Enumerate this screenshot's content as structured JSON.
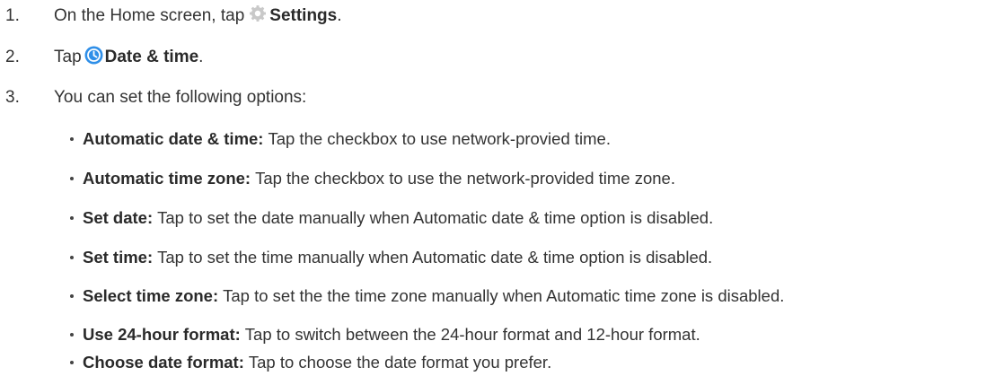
{
  "steps": [
    {
      "num": "1.",
      "pre": "On the Home screen, tap ",
      "icon": "gear-icon",
      "bold": "Settings",
      "post": "."
    },
    {
      "num": "2.",
      "pre": "Tap ",
      "icon": "clock-icon",
      "bold": "Date & time",
      "post": "."
    },
    {
      "num": "3.",
      "pre": "You can set the following options:",
      "icon": "",
      "bold": "",
      "post": ""
    }
  ],
  "options": [
    {
      "term": "Automatic date & time:",
      "desc": "Tap the checkbox to use network-provied time."
    },
    {
      "term": "Automatic time zone:",
      "desc": "Tap the checkbox to use the network-provided time zone."
    },
    {
      "term": "Set date:",
      "desc": "Tap to set the date manually when Automatic date & time option is disabled."
    },
    {
      "term": "Set time:",
      "desc": "Tap to set the time manually when Automatic date & time option is disabled."
    },
    {
      "term": "Select time zone:",
      "desc": "Tap to set the the time zone manually when Automatic time zone is disabled."
    },
    {
      "term": "Use 24-hour format:",
      "desc": "Tap to switch between the 24-hour format and 12-hour format."
    },
    {
      "term": "Choose date format:",
      "desc": "Tap to choose the date format you prefer."
    }
  ],
  "colors": {
    "gear_icon": "#c9c9c9",
    "clock_icon": "#2f8fe8",
    "text": "#333333"
  }
}
